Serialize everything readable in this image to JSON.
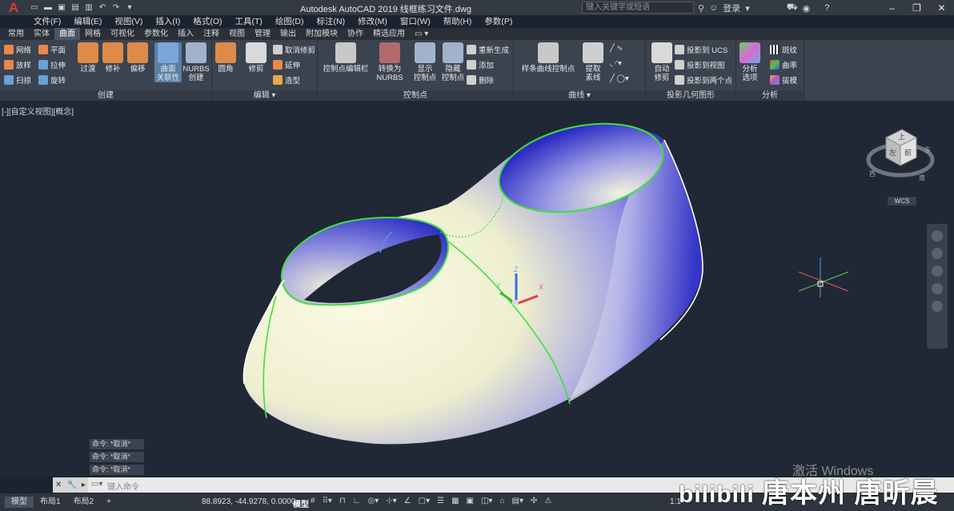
{
  "app": {
    "title": "Autodesk AutoCAD 2019    线框练习文件.dwg",
    "search_placeholder": "键入关键字或短语",
    "login": "登录"
  },
  "menu": [
    "文件(F)",
    "编辑(E)",
    "视图(V)",
    "插入(I)",
    "格式(O)",
    "工具(T)",
    "绘图(D)",
    "标注(N)",
    "修改(M)",
    "窗口(W)",
    "帮助(H)",
    "参数(P)"
  ],
  "tabs": [
    "常用",
    "实体",
    "曲面",
    "网格",
    "可视化",
    "参数化",
    "插入",
    "注释",
    "视图",
    "管理",
    "输出",
    "附加模块",
    "协作",
    "精选应用"
  ],
  "active_tab": "曲面",
  "ribbon": {
    "create": {
      "title": "创建",
      "small": [
        "网络",
        "放样",
        "扫掠",
        "平面",
        "拉伸",
        "旋转"
      ],
      "big": [
        "过渡",
        "修补",
        "偏移"
      ],
      "assoc": "曲面\n关联性",
      "nurbs": "NURBS\n创建"
    },
    "edit": {
      "title": "编辑",
      "fillet": "圆角",
      "trim": "修剪",
      "small": [
        "取消修剪",
        "延伸",
        "造型"
      ]
    },
    "cv": {
      "title": "控制点",
      "editbar": "控制点编辑栏",
      "to_nurbs": "转换为\nNURBS",
      "show": "显示\n控制点",
      "hide": "隐藏\n控制点",
      "small": [
        "重新生成",
        "添加",
        "删除"
      ]
    },
    "curves": {
      "title": "曲线",
      "spline": "样条曲线控制点",
      "extract": "提取\n素线"
    },
    "project": {
      "title": "投影几何图形",
      "auto_trim": "自动\n修剪",
      "small": [
        "投影到 UCS",
        "投影到视图",
        "投影到两个点"
      ]
    },
    "analysis": {
      "title": "分析",
      "options": "分析\n选项",
      "small": [
        "斑纹",
        "曲率",
        "拔模"
      ]
    }
  },
  "viewport": {
    "label": "[-][自定义视图][概念]",
    "cube_top": "上",
    "cube_front": "前",
    "cube_left": "左",
    "compass_w": "西",
    "compass_s": "南",
    "compass_e": "东",
    "wcs": "WCS",
    "ucs_x": "X",
    "ucs_y": "Y",
    "ucs_z": "Z"
  },
  "command_history": [
    "命令: *取消*",
    "命令: *取消*",
    "命令: *取消*"
  ],
  "command_prompt": "键入命令",
  "status": {
    "layouts": [
      "模型",
      "布局1",
      "布局2"
    ],
    "coords": "88.8923, -44.9278, 0.0000",
    "model": "模型",
    "scale": "1:1"
  },
  "windows_notice": "激活 Windows",
  "watermark": "唐本州 唐昕晨",
  "colors": {
    "surface_light": "#f5f4d8",
    "surface_shade": "#3a3ad0",
    "edge_green": "#3fe03f",
    "viewport_bg": "#202835",
    "ribbon_bg": "#3b4350"
  }
}
